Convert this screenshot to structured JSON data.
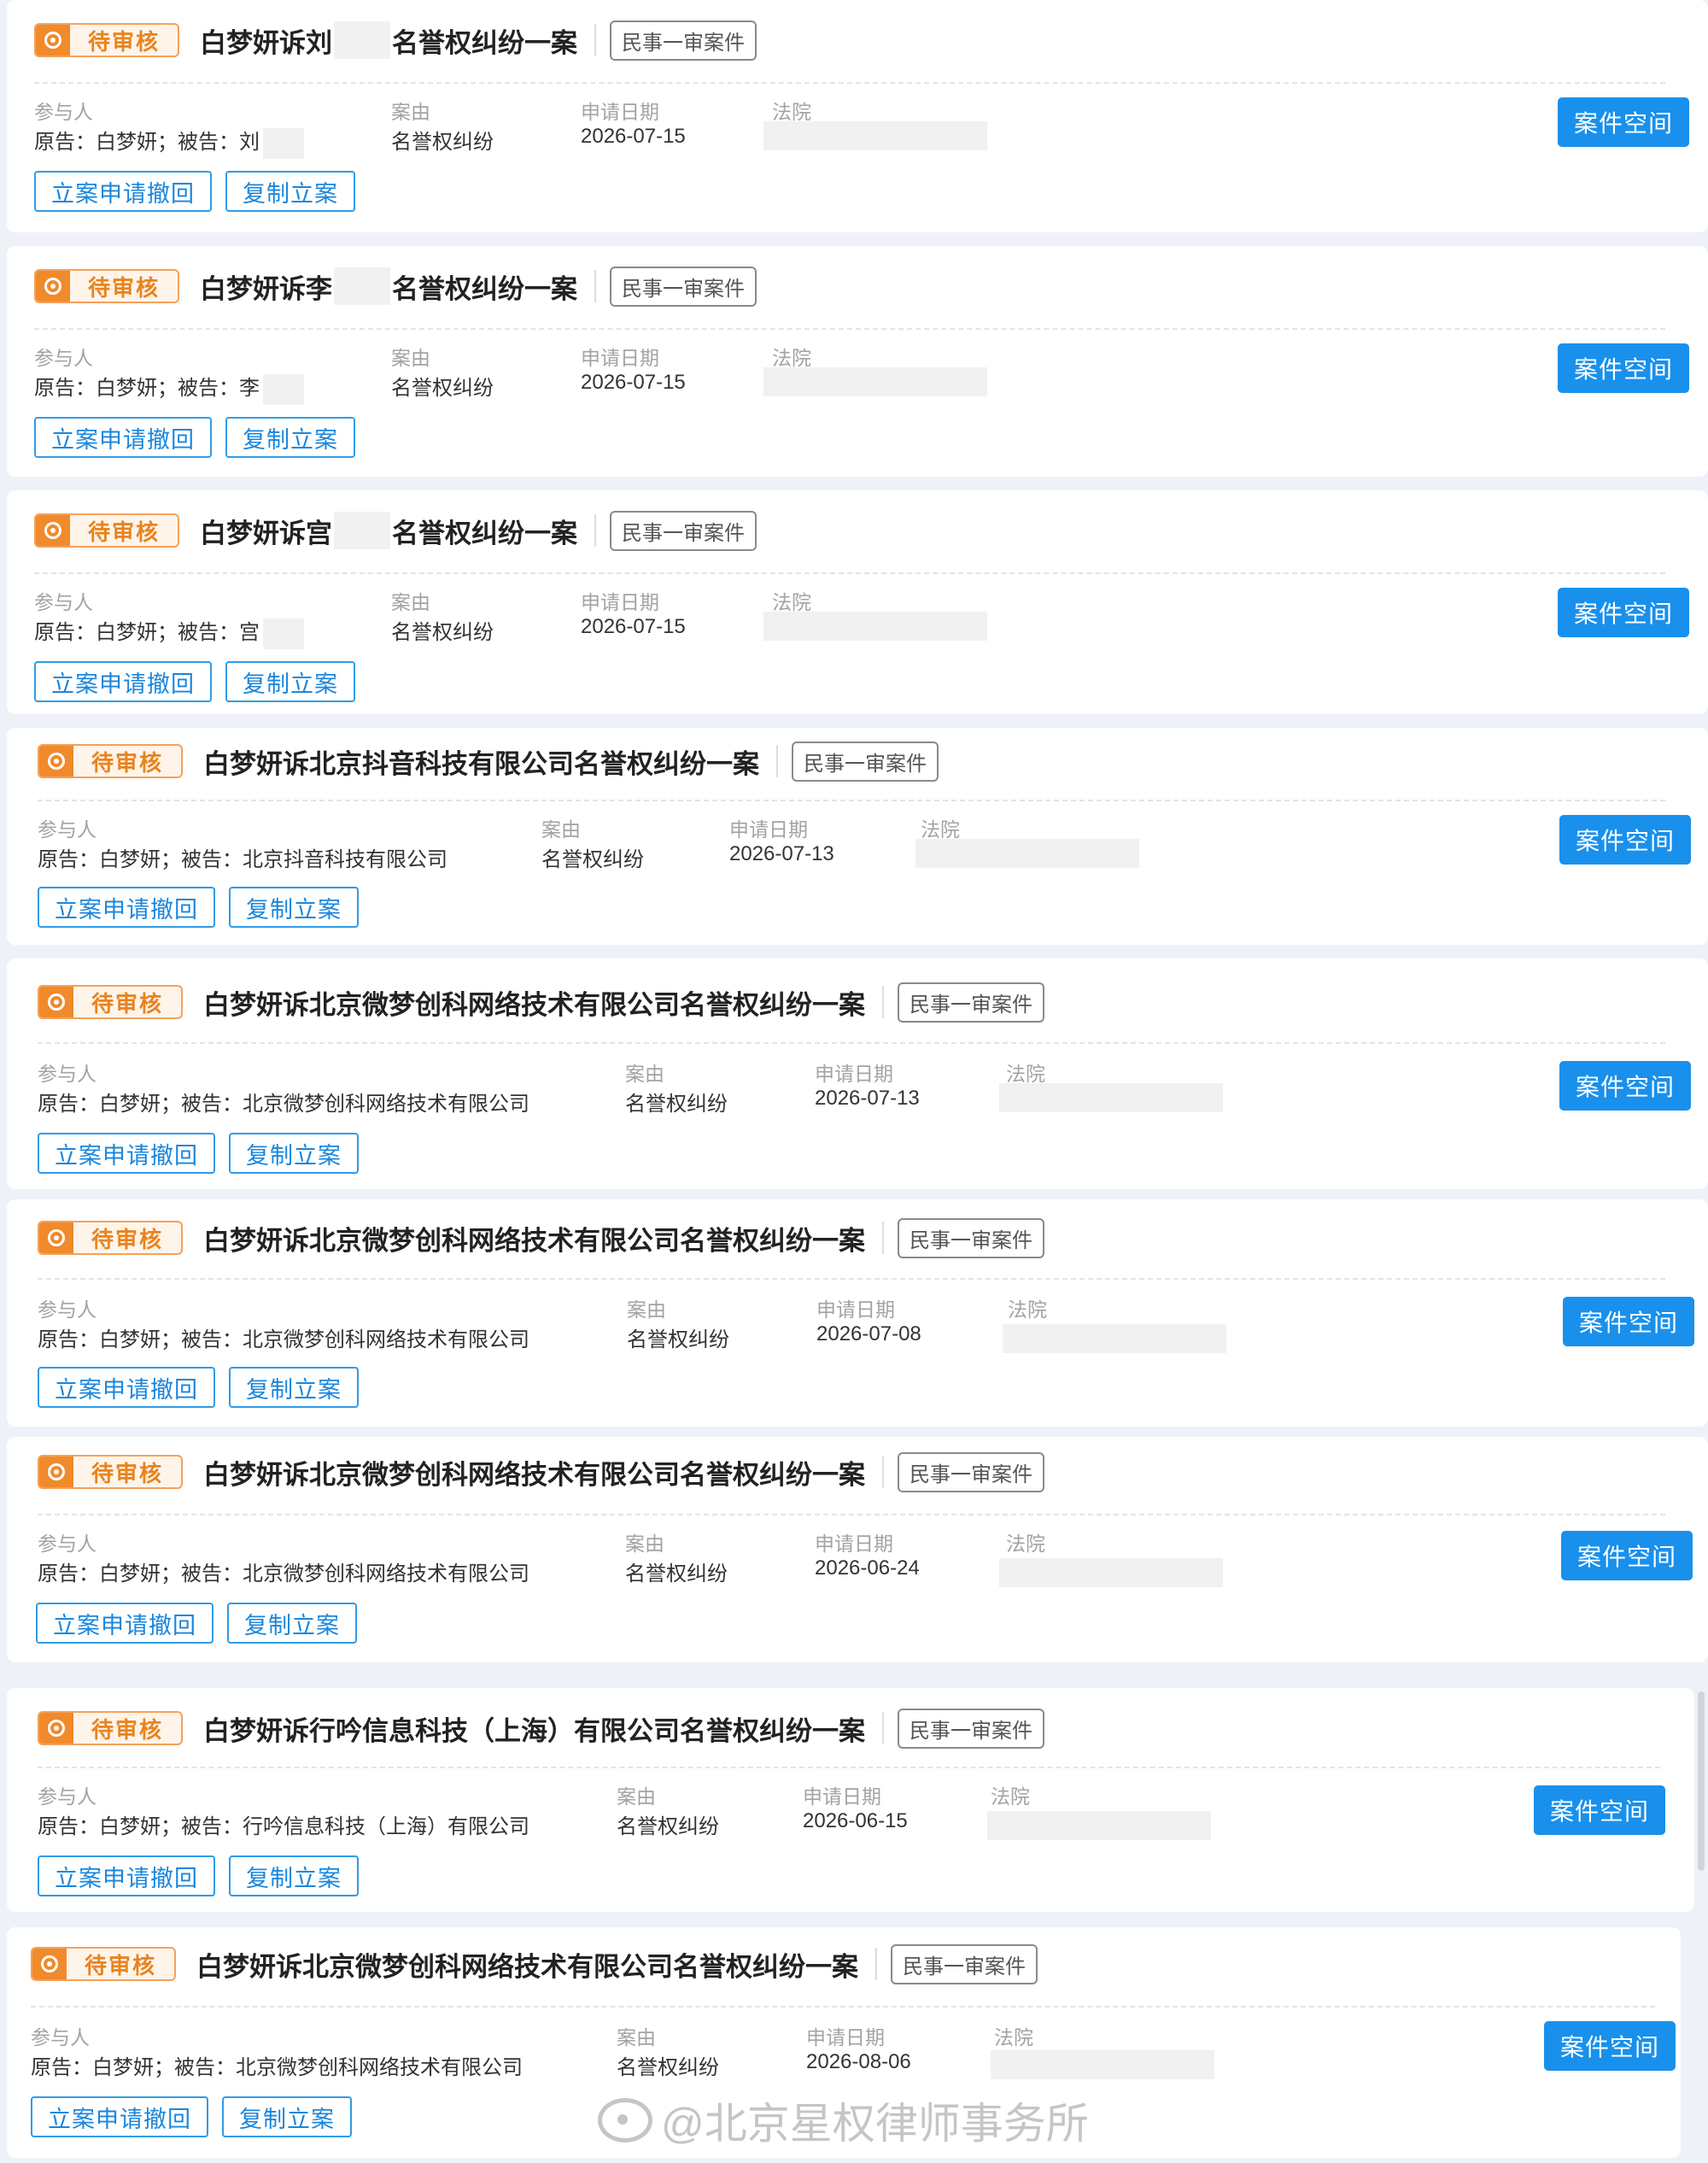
{
  "cases": [
    {
      "status": "待审核",
      "title_prefix": "白梦妍诉刘",
      "title_suffix": "名誉权纠纷一案",
      "tag": "民事一审案件",
      "labels": {
        "participants": "参与人",
        "cause": "案由",
        "date": "申请日期",
        "court": "法院"
      },
      "participants": "原告：白梦妍；被告：刘",
      "cause": "名誉权纠纷",
      "date": "2026-07-15",
      "btn_withdraw": "立案申请撤回",
      "btn_copy": "复制立案",
      "btn_space": "案件空间"
    },
    {
      "status": "待审核",
      "title_prefix": "白梦妍诉李",
      "title_suffix": "名誉权纠纷一案",
      "tag": "民事一审案件",
      "labels": {
        "participants": "参与人",
        "cause": "案由",
        "date": "申请日期",
        "court": "法院"
      },
      "participants": "原告：白梦妍；被告：李",
      "cause": "名誉权纠纷",
      "date": "2026-07-15",
      "btn_withdraw": "立案申请撤回",
      "btn_copy": "复制立案",
      "btn_space": "案件空间"
    },
    {
      "status": "待审核",
      "title_prefix": "白梦妍诉宫",
      "title_suffix": "名誉权纠纷一案",
      "tag": "民事一审案件",
      "labels": {
        "participants": "参与人",
        "cause": "案由",
        "date": "申请日期",
        "court": "法院"
      },
      "participants": "原告：白梦妍；被告：宫",
      "cause": "名誉权纠纷",
      "date": "2026-07-15",
      "btn_withdraw": "立案申请撤回",
      "btn_copy": "复制立案",
      "btn_space": "案件空间"
    },
    {
      "status": "待审核",
      "title": "白梦妍诉北京抖音科技有限公司名誉权纠纷一案",
      "tag": "民事一审案件",
      "labels": {
        "participants": "参与人",
        "cause": "案由",
        "date": "申请日期",
        "court": "法院"
      },
      "participants": "原告：白梦妍；被告：北京抖音科技有限公司",
      "cause": "名誉权纠纷",
      "date": "2026-07-13",
      "btn_withdraw": "立案申请撤回",
      "btn_copy": "复制立案",
      "btn_space": "案件空间"
    },
    {
      "status": "待审核",
      "title": "白梦妍诉北京微梦创科网络技术有限公司名誉权纠纷一案",
      "tag": "民事一审案件",
      "labels": {
        "participants": "参与人",
        "cause": "案由",
        "date": "申请日期",
        "court": "法院"
      },
      "participants": "原告：白梦妍；被告：北京微梦创科网络技术有限公司",
      "cause": "名誉权纠纷",
      "date": "2026-07-13",
      "btn_withdraw": "立案申请撤回",
      "btn_copy": "复制立案",
      "btn_space": "案件空间"
    },
    {
      "status": "待审核",
      "title": "白梦妍诉北京微梦创科网络技术有限公司名誉权纠纷一案",
      "tag": "民事一审案件",
      "labels": {
        "participants": "参与人",
        "cause": "案由",
        "date": "申请日期",
        "court": "法院"
      },
      "participants": "原告：白梦妍；被告：北京微梦创科网络技术有限公司",
      "cause": "名誉权纠纷",
      "date": "2026-07-08",
      "btn_withdraw": "立案申请撤回",
      "btn_copy": "复制立案",
      "btn_space": "案件空间"
    },
    {
      "status": "待审核",
      "title": "白梦妍诉北京微梦创科网络技术有限公司名誉权纠纷一案",
      "tag": "民事一审案件",
      "labels": {
        "participants": "参与人",
        "cause": "案由",
        "date": "申请日期",
        "court": "法院"
      },
      "participants": "原告：白梦妍；被告：北京微梦创科网络技术有限公司",
      "cause": "名誉权纠纷",
      "date": "2026-06-24",
      "btn_withdraw": "立案申请撤回",
      "btn_copy": "复制立案",
      "btn_space": "案件空间"
    },
    {
      "status": "待审核",
      "title": "白梦妍诉行吟信息科技（上海）有限公司名誉权纠纷一案",
      "tag": "民事一审案件",
      "labels": {
        "participants": "参与人",
        "cause": "案由",
        "date": "申请日期",
        "court": "法院"
      },
      "participants": "原告：白梦妍；被告：行吟信息科技（上海）有限公司",
      "cause": "名誉权纠纷",
      "date": "2026-06-15",
      "btn_withdraw": "立案申请撤回",
      "btn_copy": "复制立案",
      "btn_space": "案件空间"
    },
    {
      "status": "待审核",
      "title": "白梦妍诉北京微梦创科网络技术有限公司名誉权纠纷一案",
      "tag": "民事一审案件",
      "labels": {
        "participants": "参与人",
        "cause": "案由",
        "date": "申请日期",
        "court": "法院"
      },
      "participants": "原告：白梦妍；被告：北京微梦创科网络技术有限公司",
      "cause": "名誉权纠纷",
      "date": "2026-08-06",
      "btn_withdraw": "立案申请撤回",
      "btn_copy": "复制立案",
      "btn_space": "案件空间"
    }
  ],
  "watermark": "@北京星权律师事务所",
  "colors": {
    "status_orange": "#f08a2b",
    "primary_blue": "#1990ec",
    "outline_blue": "#2f9be8",
    "page_bg": "#eef2f8"
  }
}
